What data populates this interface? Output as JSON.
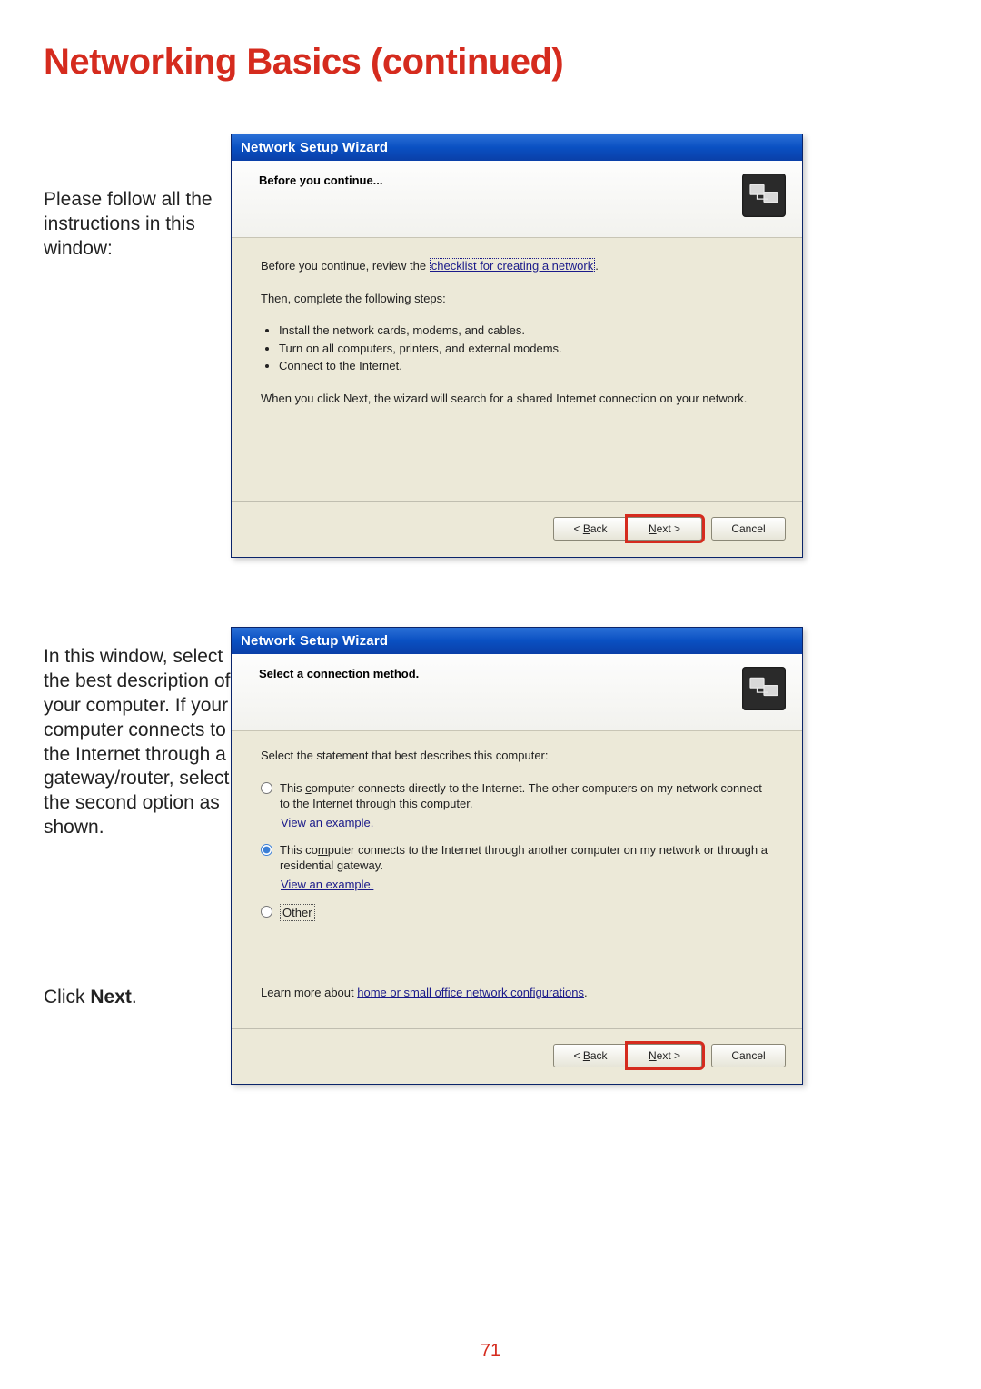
{
  "page": {
    "title": "Networking Basics (continued)",
    "number": "71"
  },
  "instruction1": "Please follow all the instructions in this window:",
  "instruction2": "In this window, select the best description of your computer. If your computer connects to the Internet through a gateway/router, select the second option as shown.",
  "clickNextPrefix": "Click ",
  "clickNextBold": "Next",
  "clickNextSuffix": ".",
  "wizard1": {
    "title": "Network Setup Wizard",
    "header": "Before you continue...",
    "reviewPrefix": "Before you continue, review the ",
    "reviewLink": "checklist for creating a network",
    "reviewSuffix": ".",
    "stepsIntro": "Then, complete the following steps:",
    "steps": [
      "Install the network cards, modems, and cables.",
      "Turn on all computers, printers, and external modems.",
      "Connect to the Internet."
    ],
    "footerNote": "When you click Next, the wizard will search for a shared Internet connection on your network.",
    "buttons": {
      "back": "< Back",
      "next": "Next >",
      "cancel": "Cancel"
    }
  },
  "wizard2": {
    "title": "Network Setup Wizard",
    "header": "Select a connection method.",
    "selectStatement": "Select the statement that best describes this computer:",
    "option1": "This computer connects directly to the Internet. The other computers on my network connect to the Internet through this computer.",
    "option2": "This computer connects to the Internet through another computer on my network or through a residential gateway.",
    "viewExample": "View an example.",
    "other": "Other",
    "learnMorePrefix": "Learn more about ",
    "learnMoreLink": "home or small office network configurations",
    "learnMoreSuffix": ".",
    "buttons": {
      "back": "< Back",
      "next": "Next >",
      "cancel": "Cancel"
    }
  }
}
